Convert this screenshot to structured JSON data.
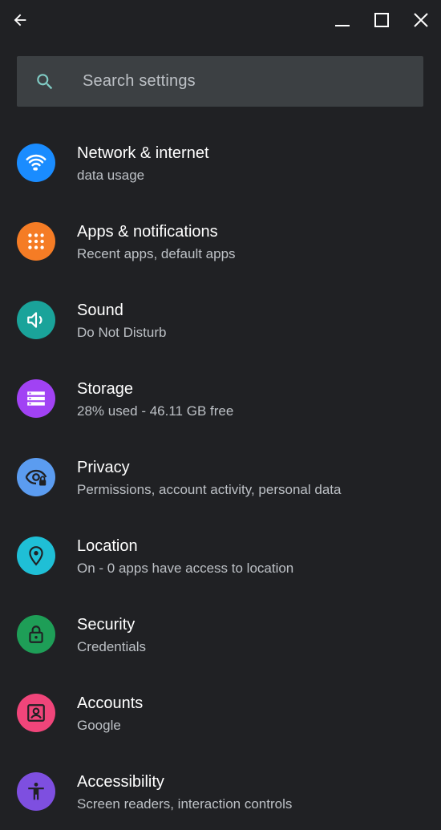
{
  "window": {
    "back_icon": "arrow-left-icon",
    "minimize_icon": "minimize-icon",
    "maximize_icon": "maximize-icon",
    "close_icon": "close-icon"
  },
  "search": {
    "placeholder": "Search settings",
    "icon": "search-icon",
    "icon_color": "#80cbc4"
  },
  "settings": [
    {
      "title": "Network & internet",
      "subtitle": "data usage",
      "icon": "wifi-icon",
      "color": "#1a8cff"
    },
    {
      "title": "Apps & notifications",
      "subtitle": "Recent apps, default apps",
      "icon": "apps-grid-icon",
      "color": "#f57c25"
    },
    {
      "title": "Sound",
      "subtitle": "Do Not Disturb",
      "icon": "volume-icon",
      "color": "#1aa39a"
    },
    {
      "title": "Storage",
      "subtitle": "28% used - 46.11 GB free",
      "icon": "storage-icon",
      "color": "#a142f4"
    },
    {
      "title": "Privacy",
      "subtitle": "Permissions, account activity, personal data",
      "icon": "privacy-eye-icon",
      "color": "#5b9cf0"
    },
    {
      "title": "Location",
      "subtitle": "On - 0 apps have access to location",
      "icon": "location-pin-icon",
      "color": "#1fbfd6"
    },
    {
      "title": "Security",
      "subtitle": "Credentials",
      "icon": "lock-icon",
      "color": "#1e9e57"
    },
    {
      "title": "Accounts",
      "subtitle": "Google",
      "icon": "account-box-icon",
      "color": "#f0457a"
    },
    {
      "title": "Accessibility",
      "subtitle": "Screen readers, interaction controls",
      "icon": "accessibility-icon",
      "color": "#7e4fe0"
    }
  ]
}
